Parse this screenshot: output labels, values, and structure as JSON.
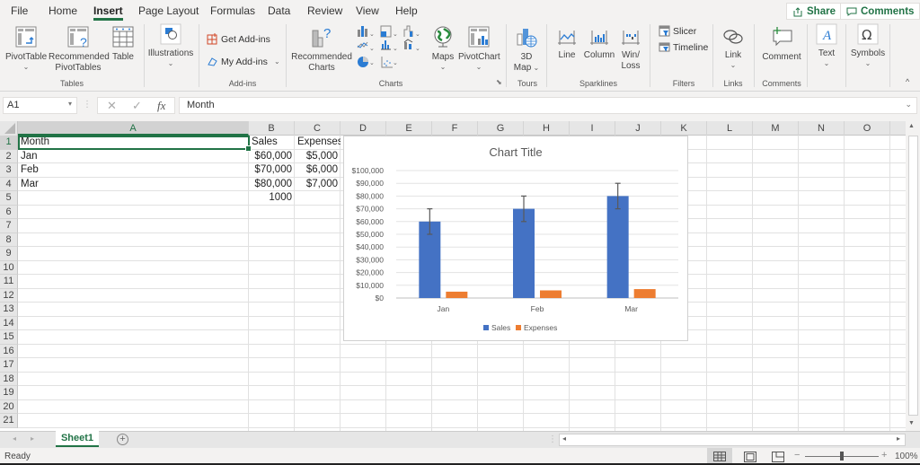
{
  "menu": {
    "tabs": [
      {
        "label": "File"
      },
      {
        "label": "Home"
      },
      {
        "label": "Insert",
        "active": true
      },
      {
        "label": "Page Layout"
      },
      {
        "label": "Formulas"
      },
      {
        "label": "Data"
      },
      {
        "label": "Review"
      },
      {
        "label": "View"
      },
      {
        "label": "Help"
      }
    ],
    "share_label": "Share",
    "comments_label": "Comments"
  },
  "ribbon": {
    "groups": {
      "tables": "Tables",
      "addins": "Add-ins",
      "charts": "Charts",
      "tours": "Tours",
      "sparklines": "Sparklines",
      "filters": "Filters",
      "links": "Links",
      "comments": "Comments"
    },
    "buttons": {
      "pivottable": "PivotTable",
      "recommended_pivottables_1": "Recommended",
      "recommended_pivottables_2": "PivotTables",
      "table": "Table",
      "illustrations": "Illustrations",
      "get_addins": "Get Add-ins",
      "my_addins": "My Add-ins",
      "recommended_charts_1": "Recommended",
      "recommended_charts_2": "Charts",
      "maps": "Maps",
      "pivotchart": "PivotChart",
      "map3d_1": "3D",
      "map3d_2": "Map",
      "line": "Line",
      "column": "Column",
      "winloss_1": "Win/",
      "winloss_2": "Loss",
      "slicer": "Slicer",
      "timeline": "Timeline",
      "link": "Link",
      "comment": "Comment",
      "text": "Text",
      "symbols": "Symbols"
    }
  },
  "formula_bar": {
    "name_box": "A1",
    "formula": "Month"
  },
  "sheet": {
    "columns": [
      "A",
      "B",
      "C",
      "D",
      "E",
      "F",
      "G",
      "H",
      "I",
      "J",
      "K",
      "L",
      "M",
      "N",
      "O"
    ],
    "rows": [
      "1",
      "2",
      "3",
      "4",
      "5",
      "6",
      "7",
      "8",
      "9",
      "10",
      "11",
      "12",
      "13",
      "14",
      "15",
      "16",
      "17",
      "18",
      "19",
      "20",
      "21"
    ],
    "cells": {
      "A1": "Month",
      "B1": "Sales",
      "C1": "Expenses",
      "A2": "Jan",
      "B2": "$60,000",
      "C2": "$5,000",
      "A3": "Feb",
      "B3": "$70,000",
      "C3": "$6,000",
      "A4": "Mar",
      "B4": "$80,000",
      "C4": "$7,000",
      "B5": "1000"
    },
    "selected_cell": "A1"
  },
  "chart_data": {
    "type": "bar",
    "title": "Chart Title",
    "categories": [
      "Jan",
      "Feb",
      "Mar"
    ],
    "series": [
      {
        "name": "Sales",
        "values": [
          60000,
          70000,
          80000
        ],
        "color": "#4472c4",
        "error_bar": 10000
      },
      {
        "name": "Expenses",
        "values": [
          5000,
          6000,
          7000
        ],
        "color": "#ed7d31"
      }
    ],
    "xlabel": "",
    "ylabel": "",
    "ylim": [
      0,
      100000
    ],
    "yticks": [
      "$0",
      "$10,000",
      "$20,000",
      "$30,000",
      "$40,000",
      "$50,000",
      "$60,000",
      "$70,000",
      "$80,000",
      "$90,000",
      "$100,000"
    ],
    "grid": true,
    "legend": "bottom"
  },
  "sheet_tabs": {
    "tabs": [
      {
        "label": "Sheet1",
        "active": true
      }
    ],
    "add_label": "+"
  },
  "status": {
    "ready": "Ready",
    "zoom_level": "100%",
    "zoom_minus": "−",
    "zoom_plus": "+"
  },
  "colors": {
    "accent": "#217346"
  }
}
